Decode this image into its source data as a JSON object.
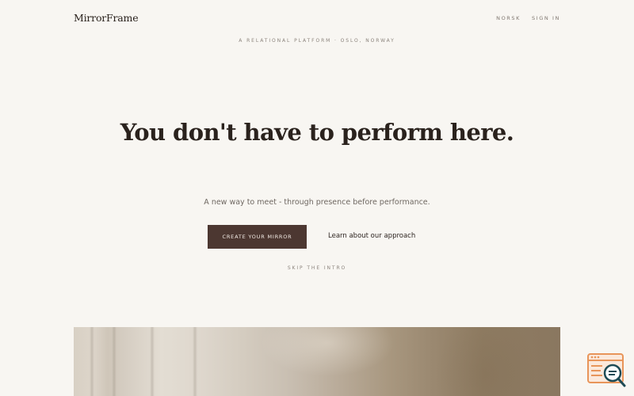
{
  "header": {
    "logo": "MirrorFrame",
    "nav": [
      "NORSK",
      "SIGN IN"
    ]
  },
  "hero": {
    "tagline": "A RELATIONAL PLATFORM · OSLO, NORWAY",
    "headline": "You don't have to perform here.",
    "subtitle": "A new way to meet - through presence before performance.",
    "cta_label": "CREATE YOUR MIRROR",
    "secondary_link": "Learn about our approach",
    "skip_label": "SKIP THE INTRO"
  },
  "colors": {
    "background": "#f8f6f2",
    "text": "#2a221d",
    "muted": "#8b837c",
    "button": "#4c3731",
    "button_text": "#f3ece6",
    "widget_orange": "#e8955a",
    "widget_teal": "#1e4b55"
  },
  "icons": {
    "widget": "browser-search-icon"
  }
}
